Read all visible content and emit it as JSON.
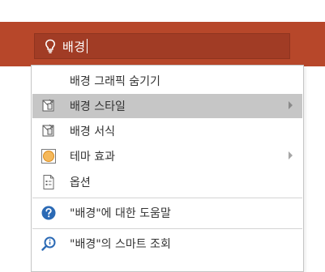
{
  "search": {
    "query": "배경"
  },
  "menu": {
    "items": [
      {
        "label": "배경 그래픽 숨기기",
        "icon": "none"
      },
      {
        "label": "배경 스타일",
        "icon": "format-background-icon",
        "submenu": true,
        "highlighted": true
      },
      {
        "label": "배경 서식",
        "icon": "format-background-icon"
      },
      {
        "label": "테마 효과",
        "icon": "theme-effects-icon",
        "submenu": true
      },
      {
        "label": "옵션",
        "icon": "options-icon"
      },
      {
        "label": "\"배경\"에 대한 도움말",
        "icon": "help-icon"
      },
      {
        "label": "\"배경\"의 스마트 조회",
        "icon": "smart-lookup-icon"
      }
    ]
  },
  "colors": {
    "ribbon": "#b7472a",
    "search_box": "#a13c25",
    "highlight": "#c6c6c6",
    "help_icon": "#2b6ab5"
  }
}
